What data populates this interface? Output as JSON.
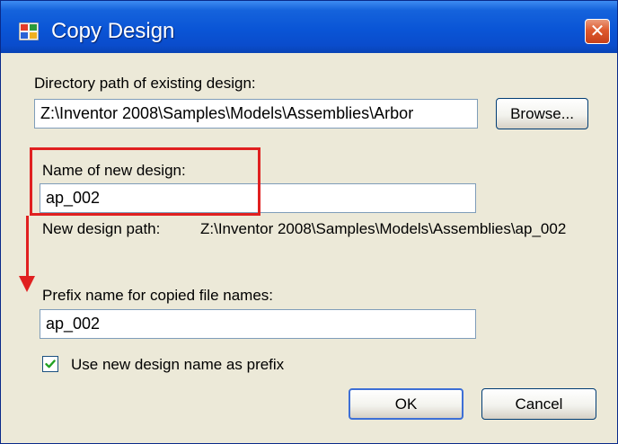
{
  "window": {
    "title": "Copy Design",
    "close_label": "✕"
  },
  "form": {
    "existing_label": "Directory path of existing design:",
    "existing_value": "Z:\\Inventor 2008\\Samples\\Models\\Assemblies\\Arbor",
    "browse_label": "Browse...",
    "new_name_label": "Name of new design:",
    "new_name_value": "ap_002",
    "new_path_label": "New design path:",
    "new_path_value": "Z:\\Inventor 2008\\Samples\\Models\\Assemblies\\ap_002",
    "prefix_label": "Prefix name for copied file names:",
    "prefix_value": "ap_002",
    "use_prefix_label": "Use new design name as prefix",
    "use_prefix_checked": true
  },
  "buttons": {
    "ok_label": "OK",
    "cancel_label": "Cancel"
  },
  "colors": {
    "titlebar": "#0a55d6",
    "annotation": "#e02020",
    "dialog_bg": "#ece9d8"
  }
}
